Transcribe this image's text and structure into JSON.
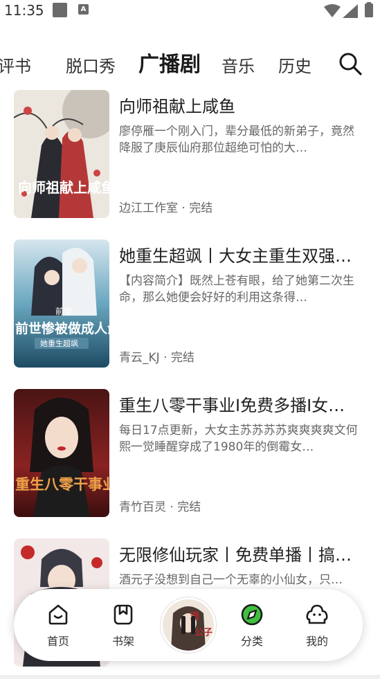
{
  "status_bar": {
    "time": "11:35",
    "icons": [
      "notification-square-icon",
      "app-notification-icon",
      "wifi-icon",
      "signal-icon",
      "battery-icon"
    ]
  },
  "tabs": [
    {
      "label": "评书",
      "active": false
    },
    {
      "label": "脱口秀",
      "active": false
    },
    {
      "label": "广播剧",
      "active": true
    },
    {
      "label": "音乐",
      "active": false
    },
    {
      "label": "历史",
      "active": false
    }
  ],
  "search_icon": "search-icon",
  "items": [
    {
      "title": "向师祖献上咸鱼",
      "description": "廖停雁一个刚入门，辈分最低的新弟子，竟然降服了庚辰仙府那位超绝可怕的大…",
      "author": "边江工作室",
      "separator": "·",
      "status": "完结",
      "cover_text": "向师祖献上咸鱼",
      "cover_colors": [
        "#e9e4dc",
        "#b63a3a",
        "#2b2b33"
      ]
    },
    {
      "title": "她重生超飒丨大女主重生双强…",
      "description": "【内容简介】既然上苍有眼，给了她第二次生命，那么她便会好好的利用这条得…",
      "author": "青云_KJ",
      "separator": "·",
      "status": "完结",
      "cover_text": "前世惨被做成人彘",
      "cover_subtext": "她重生超飒",
      "cover_colors": [
        "#5c9bb5",
        "#1f4d66",
        "#d8e7ee"
      ]
    },
    {
      "title": "重生八零干事业I免费多播I女…",
      "description": "每日17点更新，大女主苏苏苏苏爽爽爽爽文何熙一觉睡醒穿成了1980年的倒霉女…",
      "author": "青竹百灵",
      "separator": "·",
      "status": "完结",
      "cover_text": "重生八零干事业",
      "cover_colors": [
        "#6e1d1d",
        "#b8322a",
        "#e8b37a"
      ]
    },
    {
      "title": "无限修仙玩家丨免费单播丨搞…",
      "description": "酒元子没想到自己一个无辜的小仙女，只…",
      "author": "",
      "separator": "",
      "status": "",
      "cover_colors": [
        "#f2e6e6",
        "#c02a2a",
        "#3a3a44"
      ]
    }
  ],
  "bottom_nav": [
    {
      "label": "首页",
      "icon": "home-smile-icon",
      "active": false
    },
    {
      "label": "书架",
      "icon": "bookshelf-icon",
      "active": false
    },
    {
      "label": "分类",
      "icon": "category-compass-icon",
      "active": true
    },
    {
      "label": "我的",
      "icon": "profile-icon",
      "active": false
    }
  ],
  "player": {
    "icon": "pause-icon",
    "state": "playing"
  },
  "colors": {
    "accent": "#3fbf3f",
    "text": "#1f1f1f",
    "muted": "#666666"
  }
}
